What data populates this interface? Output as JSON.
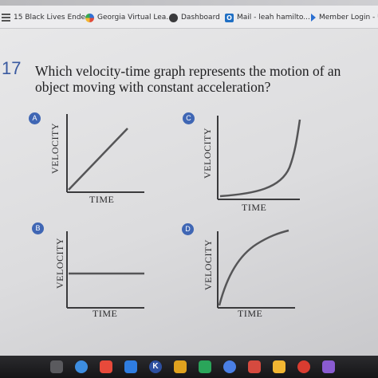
{
  "browser": {
    "bookmarks": [
      {
        "label": "15 Black Lives Ende...",
        "icon": "list-icon"
      },
      {
        "label": "Georgia Virtual Lea...",
        "icon": "gavs-icon"
      },
      {
        "label": "Dashboard",
        "icon": "dashboard-icon"
      },
      {
        "label": "Mail - leah hamilto...",
        "icon": "mail-icon"
      },
      {
        "label": "Member Login - U",
        "icon": "arrow-icon"
      }
    ],
    "mail_icon_glyph": "O"
  },
  "question": {
    "number": "17",
    "text": "Which velocity-time graph represents the motion of an object moving with constant acceleration?"
  },
  "options": [
    {
      "letter": "A",
      "ylabel": "VELOCITY",
      "xlabel": "TIME",
      "curve": "linear-increasing"
    },
    {
      "letter": "C",
      "ylabel": "VELOCITY",
      "xlabel": "TIME",
      "curve": "exponential-increasing"
    },
    {
      "letter": "B",
      "ylabel": "VELOCITY",
      "xlabel": "TIME",
      "curve": "horizontal-constant"
    },
    {
      "letter": "D",
      "ylabel": "VELOCITY",
      "xlabel": "TIME",
      "curve": "increasing-leveling-off"
    }
  ],
  "taskbar": {
    "apps": [
      {
        "name": "launcher-icon",
        "color": "#5a5a5e"
      },
      {
        "name": "camera-icon",
        "color": "#3d8de0"
      },
      {
        "name": "screencastify-icon",
        "color": "#e84a3b"
      },
      {
        "name": "files-icon",
        "color": "#2f7de1"
      },
      {
        "name": "kami-icon",
        "color": "#2d4fa0",
        "glyph": "K"
      },
      {
        "name": "chrome-icon",
        "color": "#e0a21e"
      },
      {
        "name": "meet-icon",
        "color": "#2aa55a"
      },
      {
        "name": "docs-icon",
        "color": "#4a7fe5"
      },
      {
        "name": "store-icon",
        "color": "#d64a3f"
      },
      {
        "name": "drive-icon",
        "color": "#f2b632"
      },
      {
        "name": "gmail-icon",
        "color": "#d93c30"
      },
      {
        "name": "app-icon",
        "color": "#8a5bd1"
      }
    ]
  }
}
